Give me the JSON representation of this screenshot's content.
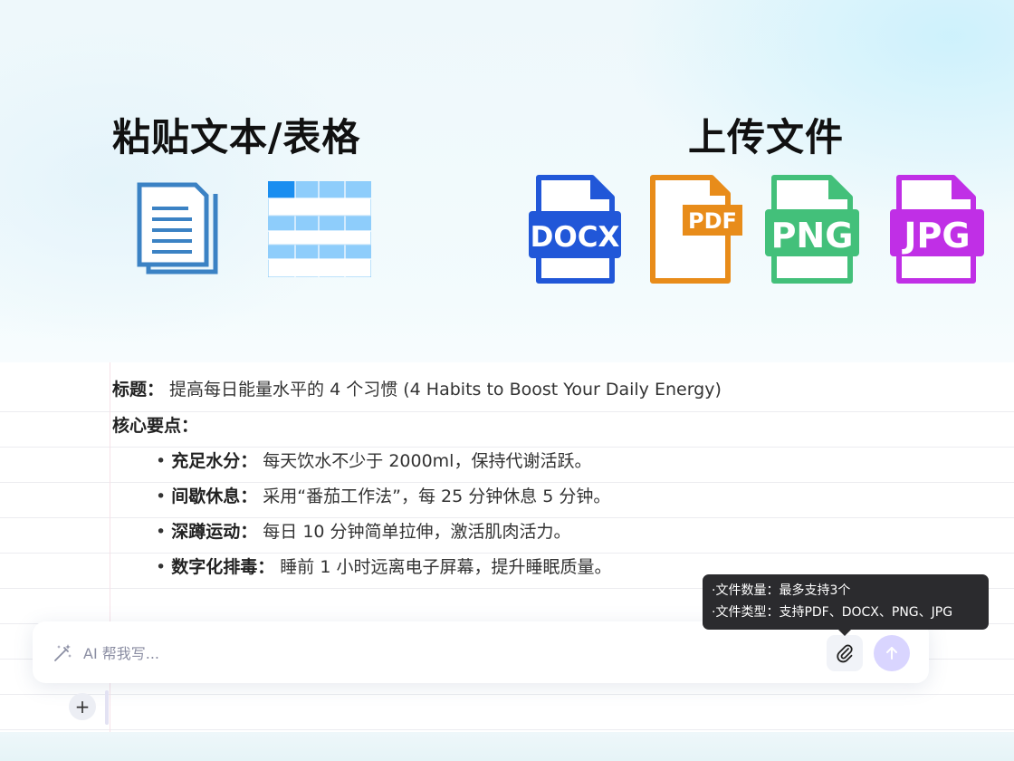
{
  "hero": {
    "paste_title": "粘贴文本/表格",
    "upload_title": "上传文件",
    "file_badges": [
      "DOCX",
      "PDF",
      "PNG",
      "JPG"
    ]
  },
  "colors": {
    "docx": "#2157d8",
    "pdf": "#e88c1a",
    "png": "#43c07a",
    "jpg": "#c02fe6",
    "doc_icon": "#3b82c4",
    "table_header": "#1a8ef0",
    "table_stripe": "#8ecdfb"
  },
  "content": {
    "title_label": "标题：",
    "title_text": " 提高每日能量水平的 4 个习惯 (4 Habits to Boost Your Daily Energy)",
    "points_label": "核心要点：",
    "bullets": [
      {
        "label": "充足水分：",
        "text": " 每天饮水不少于 2000ml，保持代谢活跃。"
      },
      {
        "label": "间歇休息：",
        "text": " 采用“番茄工作法”，每 25 分钟休息 5 分钟。"
      },
      {
        "label": "深蹲运动：",
        "text": " 每日 10 分钟简单拉伸，激活肌肉活力。"
      },
      {
        "label": "数字化排毒：",
        "text": " 睡前 1 小时远离电子屏幕，提升睡眠质量。"
      }
    ]
  },
  "tooltip": {
    "line1": "·文件数量：最多支持3个",
    "line2": "·文件类型：支持PDF、DOCX、PNG、JPG"
  },
  "input": {
    "placeholder": "AI 帮我写..."
  },
  "icons": {
    "wand": "magic-wand-icon",
    "attach": "paperclip-icon",
    "send": "arrow-up-icon",
    "add": "plus-icon"
  },
  "add_button_label": "+"
}
